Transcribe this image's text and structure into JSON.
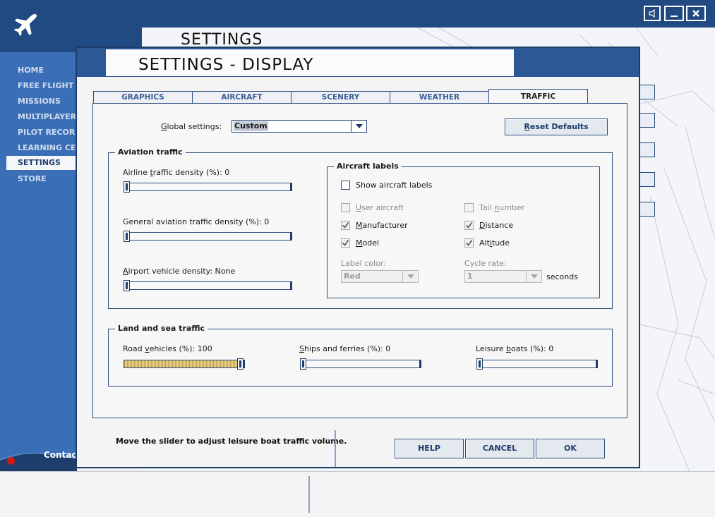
{
  "background": {
    "nav_items": [
      "HOME",
      "FREE FLIGHT",
      "MISSIONS",
      "MULTIPLAYER",
      "PILOT RECORDS",
      "LEARNING CENTER",
      "SETTINGS",
      "STORE"
    ],
    "active_nav": "SETTINGS",
    "page_title": "SETTINGS",
    "contact_label": "Contact",
    "window_controls": {
      "sound": "sound-icon",
      "minimize": "minimize-icon",
      "close": "close-icon"
    }
  },
  "dialog": {
    "title": "SETTINGS - DISPLAY",
    "tabs": [
      {
        "label": "GRAPHICS",
        "active": false
      },
      {
        "label": "AIRCRAFT",
        "active": false
      },
      {
        "label": "SCENERY",
        "active": false
      },
      {
        "label": "WEATHER",
        "active": false
      },
      {
        "label": "TRAFFIC",
        "active": true
      }
    ],
    "global_settings": {
      "label_pre": "G",
      "label_post": "lobal settings:",
      "value": "Custom"
    },
    "reset_label_pre": "R",
    "reset_label_post": "eset Defaults",
    "aviation_traffic": {
      "title": "Aviation traffic",
      "airline": {
        "label_pre": "Airline ",
        "label_ul": "t",
        "label_post": "raffic density (%): 0",
        "value": 0
      },
      "general": {
        "label_pre": "General aviation traffic density (%): 0",
        "value": 0
      },
      "vehicle": {
        "label_ul": "A",
        "label_post": "irport vehicle density: None",
        "value": 0
      }
    },
    "aircraft_labels": {
      "title": "Aircraft labels",
      "show": {
        "label": "Show aircraft labels",
        "checked": false
      },
      "user_aircraft": {
        "label_ul": "U",
        "label_post": "ser aircraft",
        "checked": false
      },
      "manufacturer": {
        "label_ul": "M",
        "label_post": "anufacturer",
        "checked": true
      },
      "model": {
        "label_ul": "M",
        "label_post": "odel",
        "checked": true
      },
      "tail_number": {
        "label_pre": "Tail ",
        "label_ul": "n",
        "label_post": "umber",
        "checked": false
      },
      "distance": {
        "label_ul": "D",
        "label_post": "istance",
        "checked": true
      },
      "altitude": {
        "label_pre": "Alt",
        "label_ul": "i",
        "label_post": "tude",
        "checked": true
      },
      "label_color": {
        "label": "Label color:",
        "value": "Red"
      },
      "cycle_rate": {
        "label": "Cycle rate:",
        "value": "1",
        "unit": "seconds"
      }
    },
    "land_sea_traffic": {
      "title": "Land and sea traffic",
      "road": {
        "label_pre": "Road ",
        "label_ul": "v",
        "label_post": "ehicles (%): 100",
        "value": 100
      },
      "ships": {
        "label_ul": "S",
        "label_post": "hips and ferries (%): 0",
        "value": 0
      },
      "leisure": {
        "label_pre": "Leisure ",
        "label_ul": "b",
        "label_post": "oats (%): 0",
        "value": 0
      }
    },
    "status_text": "Move the slider to adjust leisure boat traffic volume.",
    "buttons": {
      "help": "HELP",
      "cancel": "CANCEL",
      "ok": "OK"
    }
  }
}
